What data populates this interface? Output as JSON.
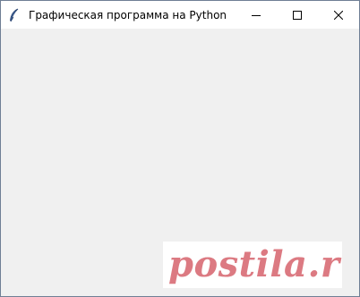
{
  "window": {
    "title": "Графическая программа на Python",
    "icon": "feather-icon",
    "buttons": {
      "minimize": "minimize-icon",
      "maximize": "maximize-icon",
      "close": "close-icon"
    },
    "client_background": "#f0f0f0"
  },
  "watermark": {
    "text": "postila.ru",
    "color": "#dc7a82"
  }
}
